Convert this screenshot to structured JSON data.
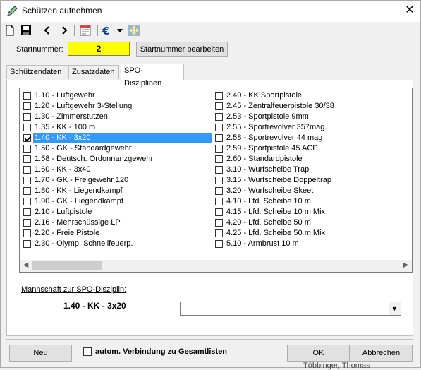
{
  "window": {
    "title": "Schützen aufnehmen",
    "close_label": "✕"
  },
  "toolbar": {
    "icons": [
      "new-document-icon",
      "save-icon",
      "previous-icon",
      "next-icon",
      "notes-icon",
      "euro-icon",
      "dropdown-arrow-icon",
      "move-icon"
    ]
  },
  "startnummer": {
    "label": "Startnummer:",
    "value": "2",
    "edit_button": "Startnummer bearbeiten"
  },
  "tabs": [
    "Schützendaten",
    "Zusatzdaten",
    "SPO-Disziplinen"
  ],
  "disciplines_left": [
    {
      "label": "1.10 - Luftgewehr",
      "checked": false
    },
    {
      "label": "1.20 - Luftgewehr 3-Stellung",
      "checked": false
    },
    {
      "label": "1.30 - Zimmerstutzen",
      "checked": false
    },
    {
      "label": "1.35 - KK - 100 m",
      "checked": false
    },
    {
      "label": "1.40 - KK - 3x20",
      "checked": true
    },
    {
      "label": "1.50 - GK - Standardgewehr",
      "checked": false
    },
    {
      "label": "1.58 - Deutsch. Ordonnanzgewehr",
      "checked": false
    },
    {
      "label": "1.60 - KK - 3x40",
      "checked": false
    },
    {
      "label": "1.70 - GK - Freigewehr 120",
      "checked": false
    },
    {
      "label": "1.80 - KK - Liegendkampf",
      "checked": false
    },
    {
      "label": "1.90 - GK - Liegendkampf",
      "checked": false
    },
    {
      "label": "2.10 - Luftpistole",
      "checked": false
    },
    {
      "label": "2.16 - Mehrschüssige LP",
      "checked": false
    },
    {
      "label": "2.20 - Freie Pistole",
      "checked": false
    },
    {
      "label": "2.30 - Olymp. Schnellfeuerp.",
      "checked": false
    }
  ],
  "disciplines_right": [
    {
      "label": "2.40 - KK Sportpistole",
      "checked": false
    },
    {
      "label": "2.45 - Zentralfeuerpistole 30/38",
      "checked": false
    },
    {
      "label": "2.53 - Sportpistole 9mm",
      "checked": false
    },
    {
      "label": "2.55 - Sportrevolver 357mag.",
      "checked": false
    },
    {
      "label": "2.58 - Sportrevolver 44 mag",
      "checked": false
    },
    {
      "label": "2.59 - Sportpistole 45 ACP",
      "checked": false
    },
    {
      "label": "2.60 - Standardpistole",
      "checked": false
    },
    {
      "label": "3.10 - Wurfscheibe Trap",
      "checked": false
    },
    {
      "label": "3.15 - Wurfscheibe Doppeltrap",
      "checked": false
    },
    {
      "label": "3.20 - Wurfscheibe Skeet",
      "checked": false
    },
    {
      "label": "4.10 - Lfd. Scheibe 10 m",
      "checked": false
    },
    {
      "label": "4.15 - Lfd. Scheibe 10 m Mix",
      "checked": false
    },
    {
      "label": "4.20 - Lfd. Scheibe 50 m",
      "checked": false
    },
    {
      "label": "4.25 - Lfd. Scheibe 50 m Mix",
      "checked": false
    },
    {
      "label": "5.10 - Armbrust 10 m",
      "checked": false
    }
  ],
  "selected_index": 4,
  "team": {
    "label": "Mannschaft zur SPO-Disziplin:",
    "discipline": "1.40 - KK - 3x20",
    "combo_value": ""
  },
  "footer": {
    "new_button": "Neu",
    "autom_label": "autom. Verbindung zu Gesamtlisten",
    "autom_checked": false,
    "ok_button": "OK",
    "cancel_button": "Abbrechen"
  },
  "background_text": "Többinger, Thomas"
}
